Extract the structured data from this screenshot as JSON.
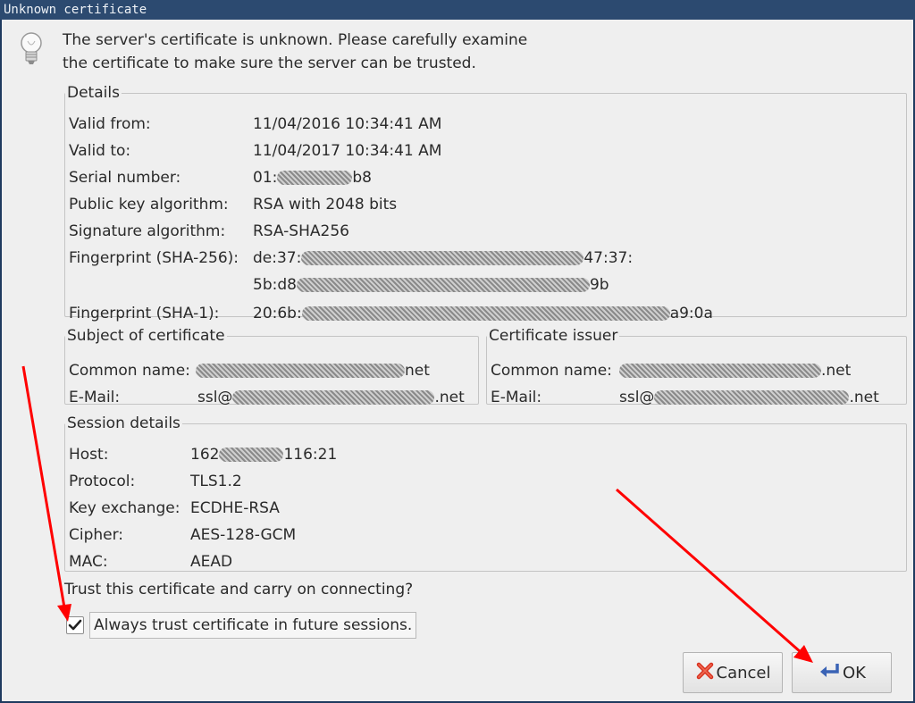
{
  "window": {
    "title": "Unknown certificate"
  },
  "intro": {
    "line1": "The server's certificate is unknown. Please carefully examine",
    "line2": "the certificate to make sure the server can be trusted."
  },
  "details": {
    "legend": "Details",
    "valid_from_label": "Valid from:",
    "valid_from": "11/04/2016 10:34:41 AM",
    "valid_to_label": "Valid to:",
    "valid_to": "11/04/2017 10:34:41 AM",
    "serial_label": "Serial number:",
    "serial_prefix": "01:",
    "serial_suffix": "b8",
    "pubkey_label": "Public key algorithm:",
    "pubkey": "RSA with 2048 bits",
    "sigalg_label": "Signature algorithm:",
    "sigalg": "RSA-SHA256",
    "fp256_label": "Fingerprint (SHA-256):",
    "fp256_l1_prefix": "de:37:",
    "fp256_l1_suffix": "47:37:",
    "fp256_l2_prefix": "5b:d8",
    "fp256_l2_suffix": "9b",
    "fp1_label": "Fingerprint (SHA-1):",
    "fp1_prefix": "20:6b:",
    "fp1_suffix": "a9:0a"
  },
  "subject": {
    "legend": "Subject of certificate",
    "cn_label": "Common name:",
    "cn_suffix": "net",
    "email_label": "E-Mail:",
    "email_prefix": "ssl@",
    "email_suffix": ".net"
  },
  "issuer": {
    "legend": "Certificate issuer",
    "cn_label": "Common name:",
    "cn_suffix": ".net",
    "email_label": "E-Mail:",
    "email_prefix": "ssl@",
    "email_suffix": ".net"
  },
  "session": {
    "legend": "Session details",
    "host_label": "Host:",
    "host_prefix": "162",
    "host_suffix": "116:21",
    "protocol_label": "Protocol:",
    "protocol": "TLS1.2",
    "kex_label": "Key exchange:",
    "kex": "ECDHE-RSA",
    "cipher_label": "Cipher:",
    "cipher": "AES-128-GCM",
    "mac_label": "MAC:",
    "mac": "AEAD"
  },
  "trust": {
    "question": "Trust this certificate and carry on connecting?",
    "always_label": "Always trust certificate in future sessions.",
    "always_checked": true
  },
  "buttons": {
    "cancel": "Cancel",
    "ok": "OK"
  },
  "icons": {
    "info": "lightbulb-icon",
    "cancel": "red-x-icon",
    "ok": "enter-arrow-icon"
  },
  "colors": {
    "annotation_arrow": "#ff0000",
    "titlebar": "#2c4a70"
  }
}
